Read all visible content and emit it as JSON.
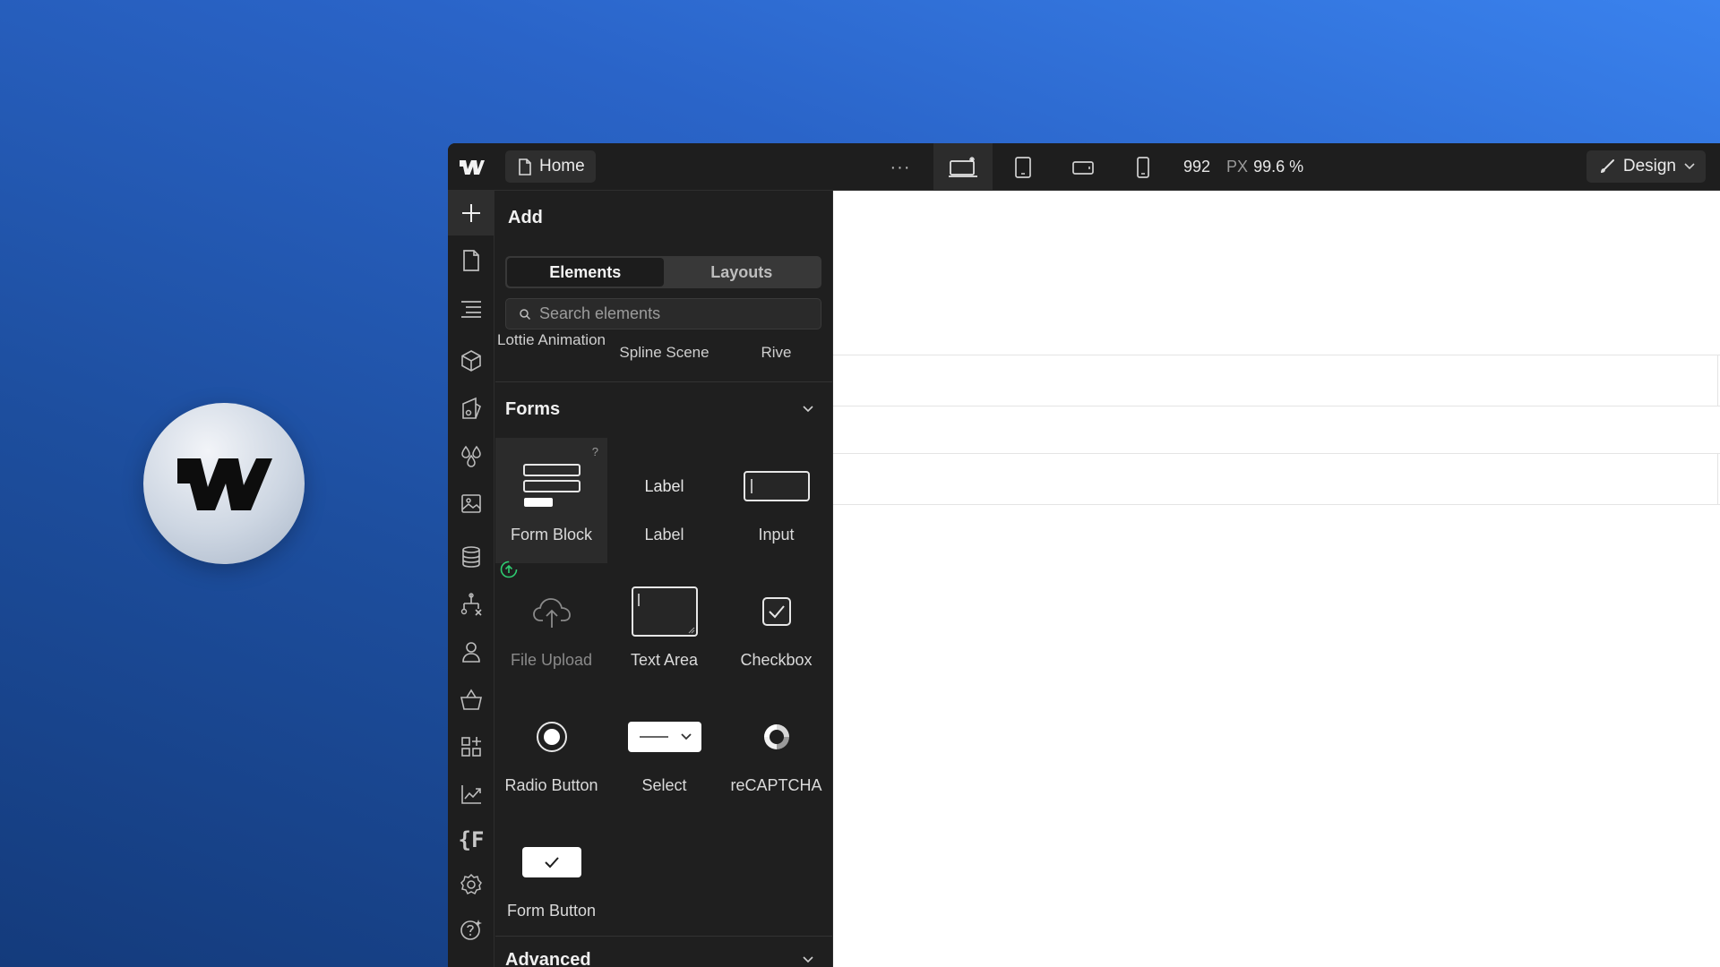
{
  "topbar": {
    "page_name": "Home",
    "more_label": "···",
    "width_value": "992",
    "width_unit": "PX",
    "zoom": "99.6 %",
    "mode_label": "Design"
  },
  "panel": {
    "title": "Add",
    "tabs": [
      {
        "label": "Elements",
        "active": true
      },
      {
        "label": "Layouts",
        "active": false
      }
    ],
    "search_placeholder": "Search elements",
    "media_items": [
      "Lottie Animation",
      "Spline Scene",
      "Rive"
    ],
    "forms_section": {
      "title": "Forms",
      "items": [
        {
          "label": "Form Block",
          "icon": "form-block-icon"
        },
        {
          "label": "Label",
          "icon": "label-icon",
          "icon_text": "Label"
        },
        {
          "label": "Input",
          "icon": "input-icon"
        },
        {
          "label": "File Upload",
          "icon": "file-upload-icon"
        },
        {
          "label": "Text Area",
          "icon": "text-area-icon"
        },
        {
          "label": "Checkbox",
          "icon": "checkbox-icon"
        },
        {
          "label": "Radio Button",
          "icon": "radio-button-icon"
        },
        {
          "label": "Select",
          "icon": "select-icon"
        },
        {
          "label": "reCAPTCHA",
          "icon": "recaptcha-icon"
        },
        {
          "label": "Form Button",
          "icon": "form-button-icon"
        }
      ],
      "help_mark": "?"
    },
    "advanced_section": {
      "title": "Advanced"
    }
  },
  "rail": {
    "items": [
      "add-icon",
      "pages-icon",
      "navigator-icon",
      "components-icon",
      "style-selectors-icon",
      "variables-icon",
      "assets-icon",
      "cms-icon",
      "logic-icon",
      "users-icon",
      "ecommerce-icon",
      "apps-icon",
      "analyze-icon",
      "finsweet-icon",
      "settings-icon",
      "help-icon"
    ],
    "finsweet_text": "{F"
  },
  "colors": {
    "app_bg": "#1e1e1e",
    "panel_bg": "#1f1f1f",
    "canvas_bg": "#ffffff",
    "accent_green": "#2ecc71",
    "bg_gradient_top": "#3a82ee",
    "bg_gradient_bottom": "#143b7c"
  }
}
